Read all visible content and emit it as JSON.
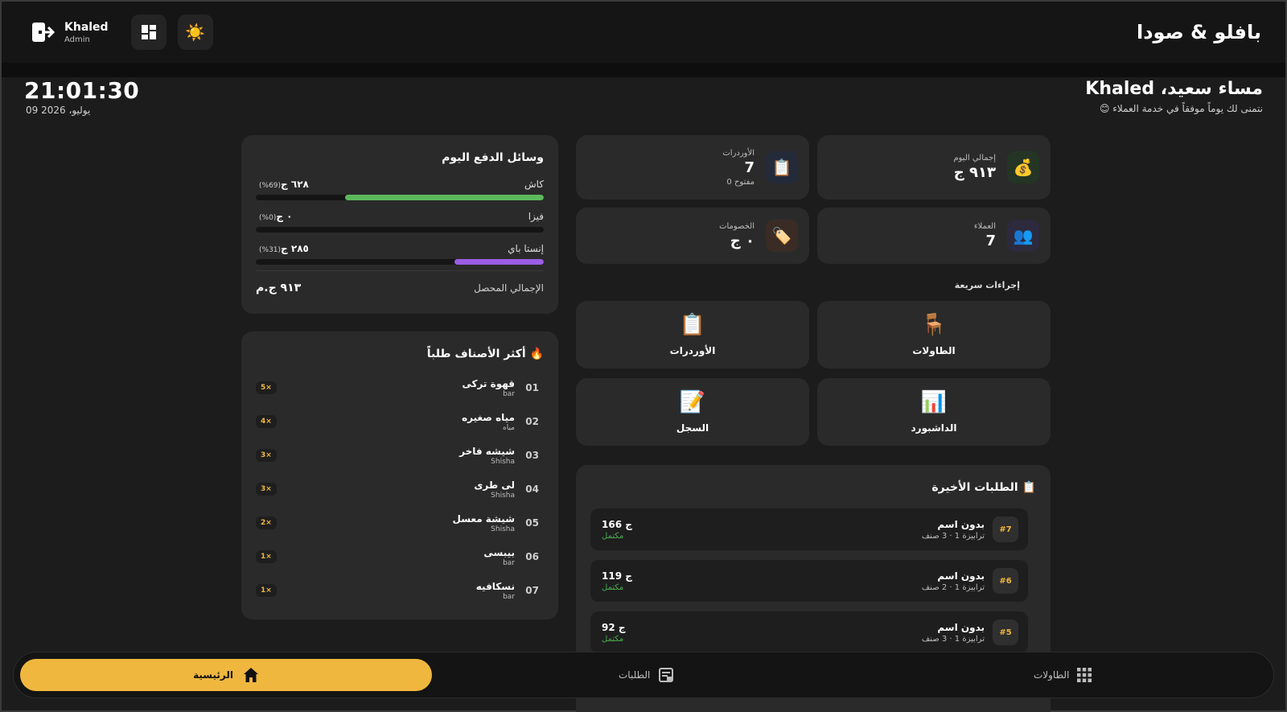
{
  "header": {
    "brand": "بافلو & صودا",
    "user_name": "Khaled",
    "user_role": "Admin",
    "icons": [
      "logout-icon",
      "dashboard-grid-icon",
      "sun-icon"
    ]
  },
  "greeting": {
    "title": "مساء سعيد، Khaled",
    "subtitle": "نتمنى لك يوماً موفقاً في خدمة العملاء 😊",
    "clock": "21:01:30",
    "date": "09 يوليو، 2026"
  },
  "stats": {
    "today_total": {
      "label": "إجمالي اليوم",
      "value": "٩١٣ ج",
      "icon": "💰"
    },
    "orders": {
      "label": "الأوردرات",
      "value": "7",
      "sub": "0 مفتوح",
      "icon": "📋"
    },
    "customers": {
      "label": "العملاء",
      "value": "7",
      "icon": "👥"
    },
    "discounts": {
      "label": "الخصومات",
      "value": "٠ ج",
      "icon": "🏷️"
    }
  },
  "quick_actions": {
    "title": "إجراءات سريعة",
    "tables": {
      "label": "الطاولات",
      "icon": "🪑"
    },
    "orders": {
      "label": "الأوردرات",
      "icon": "📋"
    },
    "dashboard": {
      "label": "الداشبورد",
      "icon": "📊"
    },
    "log": {
      "label": "السجل",
      "icon": "📝"
    }
  },
  "recent_orders": {
    "title": "📋 الطلبات الأخيرة",
    "rows": [
      {
        "id": "#7",
        "name": "بدون اسم",
        "meta": "ترابيزة 1 · 3 صنف",
        "total": "166 ج",
        "status": "مكتمل"
      },
      {
        "id": "#6",
        "name": "بدون اسم",
        "meta": "ترابيزة 1 · 2 صنف",
        "total": "119 ج",
        "status": "مكتمل"
      },
      {
        "id": "#5",
        "name": "بدون اسم",
        "meta": "ترابيزة 1 · 3 صنف",
        "total": "92 ج",
        "status": "مكتمل"
      }
    ]
  },
  "payments": {
    "title": "وسائل الدفع اليوم",
    "rows": [
      {
        "name": "كاش",
        "amount": "٦٢٨ ج",
        "pct_label": "(69%)",
        "fraction": 0.69,
        "color": "#5cb85c"
      },
      {
        "name": "فيزا",
        "amount": "٠ ج",
        "pct_label": "(0%)",
        "fraction": 0.0,
        "color": "#5c7cfa"
      },
      {
        "name": "إنستا باي",
        "amount": "٢٨٥ ج",
        "pct_label": "(31%)",
        "fraction": 0.31,
        "color": "#9b5de5"
      }
    ],
    "total_label": "الإجمالي المحصل",
    "total_value": "٩١٣ ج.م"
  },
  "top_items": {
    "title": "🔥 أكثر الأصناف طلباً",
    "rows": [
      {
        "rank": "01",
        "name": "قهوة تركى",
        "category": "bar",
        "qty": "5×"
      },
      {
        "rank": "02",
        "name": "مياه صغيره",
        "category": "مياه",
        "qty": "4×"
      },
      {
        "rank": "03",
        "name": "شيشه فاخر",
        "category": "Shisha",
        "qty": "3×"
      },
      {
        "rank": "04",
        "name": "لى طرى",
        "category": "Shisha",
        "qty": "3×"
      },
      {
        "rank": "05",
        "name": "شيشة معسل",
        "category": "Shisha",
        "qty": "2×"
      },
      {
        "rank": "06",
        "name": "بيبسى",
        "category": "bar",
        "qty": "1×"
      },
      {
        "rank": "07",
        "name": "نسكافيه",
        "category": "bar",
        "qty": "1×"
      }
    ]
  },
  "bottom_nav": {
    "home": "الرئيسية",
    "orders": "الطلبات",
    "tables": "الطاولات"
  },
  "colors": {
    "accent": "#f0b73f",
    "success": "#4caf50",
    "background": "#1c1c1c",
    "card": "#2a2a2a"
  }
}
